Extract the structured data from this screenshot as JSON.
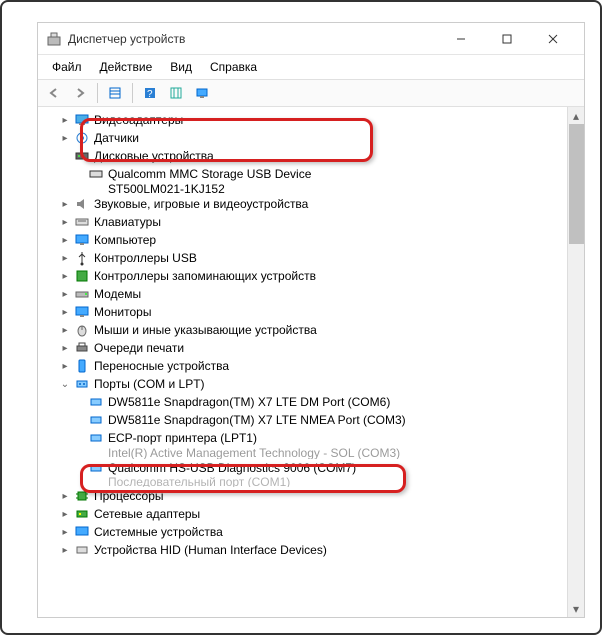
{
  "window": {
    "title": "Диспетчер устройств"
  },
  "menu": {
    "file": "Файл",
    "action": "Действие",
    "view": "Вид",
    "help": "Справка"
  },
  "tree": {
    "display_adapters": "Видеоадаптеры",
    "sensors": "Датчики",
    "disk_drives": "Дисковые устройства",
    "disk_child": "Qualcomm MMC Storage USB Device",
    "disk_child2": "ST500LM021-1KJ152",
    "sound": "Звуковые, игровые и видеоустройства",
    "keyboards": "Клавиатуры",
    "computer": "Компьютер",
    "usb_controllers": "Контроллеры USB",
    "storage_controllers": "Контроллеры запоминающих устройств",
    "modems": "Модемы",
    "monitors": "Мониторы",
    "mice": "Мыши и иные указывающие устройства",
    "print_queues": "Очереди печати",
    "portable": "Переносные устройства",
    "ports": "Порты (COM и LPT)",
    "port_dm": "DW5811e Snapdragon(TM) X7 LTE DM Port (COM6)",
    "port_nmea": "DW5811e Snapdragon(TM) X7 LTE NMEA Port (COM3)",
    "port_ecp": "ECP-порт принтера (LPT1)",
    "port_intel": "Intel(R) Active Management Technology - SOL (COM3)",
    "port_qc": "Qualcomm HS-USB Diagnostics 9006 (COM7)",
    "port_last": "Последовательный порт (COM1)",
    "processors": "Процессоры",
    "net_adapters": "Сетевые адаптеры",
    "sys_devices": "Системные устройства",
    "hid": "Устройства HID (Human Interface Devices)"
  }
}
